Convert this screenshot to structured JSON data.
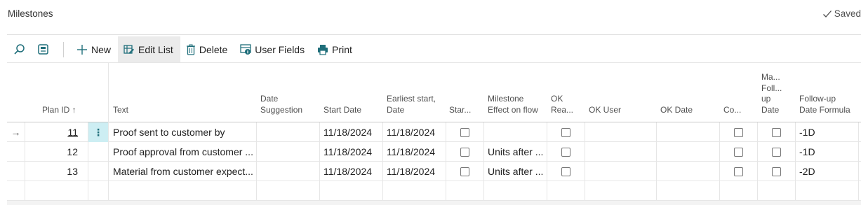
{
  "page": {
    "title": "Milestones",
    "save_label": "Saved"
  },
  "toolbar": {
    "new_label": "New",
    "edit_list_label": "Edit List",
    "delete_label": "Delete",
    "user_fields_label": "User Fields",
    "print_label": "Print"
  },
  "columns": {
    "plan_id": "Plan ID ↑",
    "text": "Text",
    "date_suggestion": "Date Suggestion",
    "start_date": "Start Date",
    "earliest_start": "Earliest start, Date",
    "start": "Star...",
    "milestone_effect": "Milestone Effect on flow",
    "ok_ready": "OK Rea...",
    "ok_user": "OK User",
    "ok_date": "OK Date",
    "co": "Co...",
    "manual_follow_up": "Ma... Foll... up Date",
    "follow_up_formula": "Follow-up Date Formula"
  },
  "rows": [
    {
      "plan_id": "11",
      "text": "Proof sent to customer by",
      "start_date": "11/18/2024",
      "earliest_start": "11/18/2024",
      "effect": "",
      "formula": "-1D",
      "selected": true
    },
    {
      "plan_id": "12",
      "text": "Proof approval from customer ...",
      "start_date": "11/18/2024",
      "earliest_start": "11/18/2024",
      "effect": "Units after ...",
      "formula": "-1D",
      "selected": false
    },
    {
      "plan_id": "13",
      "text": "Material from customer expect...",
      "start_date": "11/18/2024",
      "earliest_start": "11/18/2024",
      "effect": "Units after ...",
      "formula": "-2D",
      "selected": false
    }
  ],
  "selection_arrow": "→",
  "row_menu_glyph": "⋮",
  "colors": {
    "accent": "#1f6e7a",
    "selected_cell": "#cdeef3"
  }
}
